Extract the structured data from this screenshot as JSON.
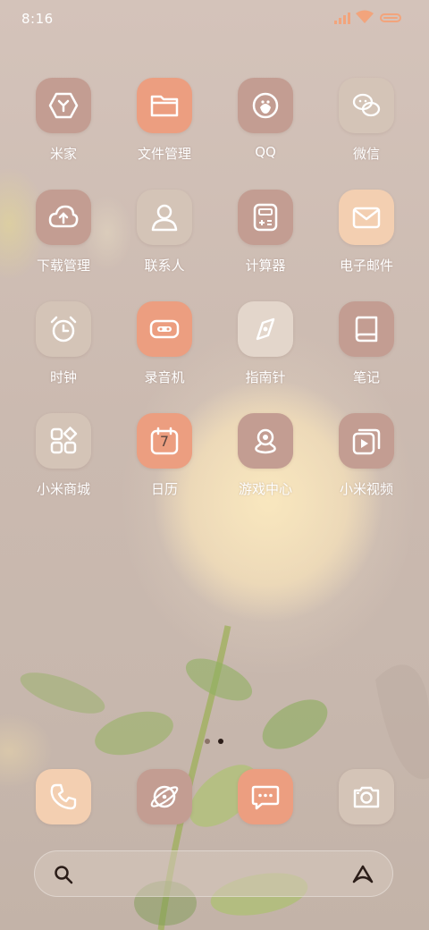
{
  "status_bar": {
    "time": "8:16",
    "icons": [
      "signal-icon",
      "wifi-icon",
      "battery-icon"
    ],
    "accent_color": "#f2a47c"
  },
  "apps": [
    {
      "label": "米家",
      "icon": "mijia-icon",
      "tile_color": "#c39d92"
    },
    {
      "label": "文件管理",
      "icon": "folder-icon",
      "tile_color": "#ec9e80"
    },
    {
      "label": "QQ",
      "icon": "qq-icon",
      "tile_color": "#c39d92"
    },
    {
      "label": "微信",
      "icon": "wechat-icon",
      "tile_color": "#d4c4b7"
    },
    {
      "label": "下载管理",
      "icon": "cloud-upload-icon",
      "tile_color": "#c39d92"
    },
    {
      "label": "联系人",
      "icon": "person-icon",
      "tile_color": "#d4c4b7"
    },
    {
      "label": "计算器",
      "icon": "calculator-icon",
      "tile_color": "#c39d92"
    },
    {
      "label": "电子邮件",
      "icon": "mail-icon",
      "tile_color": "#f3cfb1"
    },
    {
      "label": "时钟",
      "icon": "alarm-clock-icon",
      "tile_color": "#d4c4b7"
    },
    {
      "label": "录音机",
      "icon": "recorder-icon",
      "tile_color": "#ec9e80"
    },
    {
      "label": "指南针",
      "icon": "compass-icon",
      "tile_color": "#e3d6cb"
    },
    {
      "label": "笔记",
      "icon": "notebook-icon",
      "tile_color": "#c39d92"
    },
    {
      "label": "小米商城",
      "icon": "store-icon",
      "tile_color": "#d4c4b7"
    },
    {
      "label": "日历",
      "icon": "calendar-icon",
      "tile_color": "#ec9e80",
      "calendar_day": "7"
    },
    {
      "label": "游戏中心",
      "icon": "game-center-icon",
      "tile_color": "#c39d92"
    },
    {
      "label": "小米视频",
      "icon": "video-icon",
      "tile_color": "#c39d92"
    }
  ],
  "page_indicator": {
    "pages": 2,
    "active": 2
  },
  "dock": [
    {
      "icon": "phone-icon",
      "tile_color": "#f3cfb1"
    },
    {
      "icon": "browser-icon",
      "tile_color": "#c39d92"
    },
    {
      "icon": "message-icon",
      "tile_color": "#ec9e80"
    },
    {
      "icon": "camera-icon",
      "tile_color": "#d4c4b7"
    }
  ],
  "search": {
    "icon": "search-icon",
    "assistant_icon": "xiaoai-icon"
  }
}
